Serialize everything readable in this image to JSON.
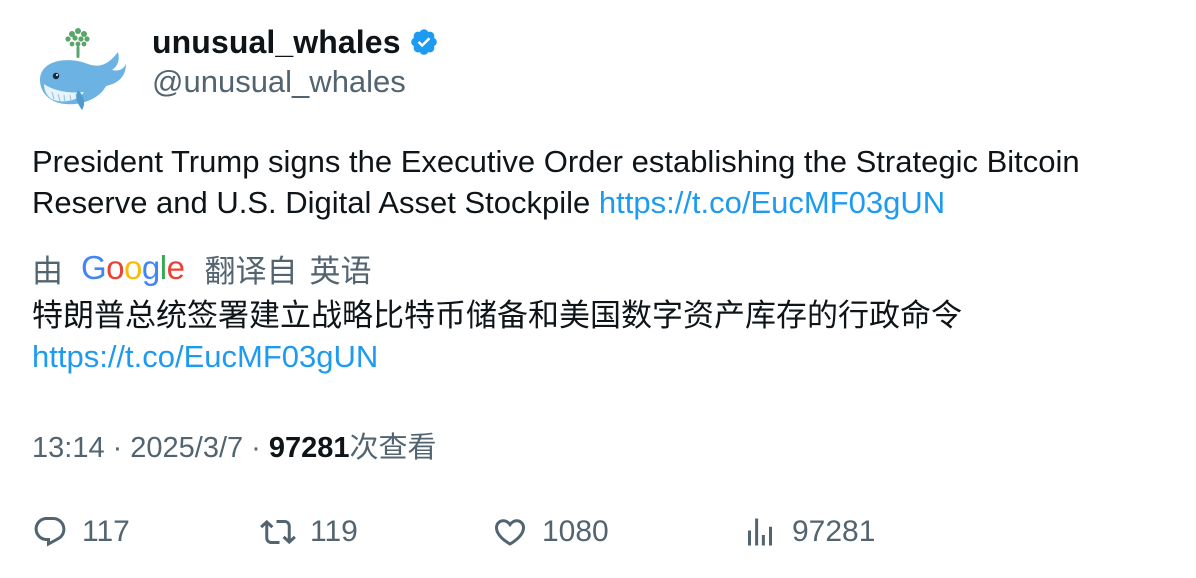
{
  "author": {
    "display_name": "unusual_whales",
    "handle": "@unusual_whales",
    "verified": true
  },
  "tweet": {
    "text": "President Trump signs the Executive Order establishing the Strategic Bitcoin Reserve and U.S. Digital Asset Stockpile ",
    "link": "https://t.co/EucMF03gUN"
  },
  "translation": {
    "by": "由",
    "provider": [
      "G",
      "o",
      "o",
      "g",
      "l",
      "e"
    ],
    "from_label": "翻译自",
    "language": "英语",
    "text": "特朗普总统签署建立战略比特币储备和美国数字资产库存的行政命令",
    "link": "https://t.co/EucMF03gUN"
  },
  "meta": {
    "time": "13:14",
    "separator": "·",
    "date": "2025/3/7",
    "views_count": "97281",
    "views_label": "次查看"
  },
  "actions": {
    "replies": "117",
    "reposts": "119",
    "likes": "1080",
    "views": "97281"
  },
  "colors": {
    "link": "#1d9bf0",
    "secondary_text": "#536471",
    "verified": "#1d9bf0"
  }
}
